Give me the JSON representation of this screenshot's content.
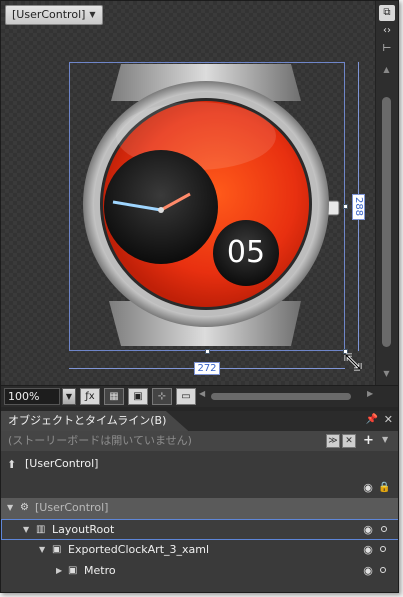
{
  "artboard": {
    "scope_button_label": "[UserControl]",
    "watch_number": "05",
    "width_label": "272",
    "height_label": "288"
  },
  "canvas_toolbar": {
    "zoom_value": "100%"
  },
  "objects_panel": {
    "tab_title": "オブジェクトとタイムライン(B)",
    "storyboard_status": "(ストーリーボードは開いていません)",
    "scope_label": "[UserControl]",
    "tree": [
      {
        "label": "[UserControl]"
      },
      {
        "label": "LayoutRoot"
      },
      {
        "label": "ExportedClockArt_3_xaml"
      },
      {
        "label": "Metro"
      }
    ]
  },
  "colors": {
    "selection": "#5e86d8",
    "dimension_text": "#3a64c8",
    "watch_face": "#e83010"
  },
  "icons": [
    "dropdown-caret-icon",
    "pan-icon",
    "code-icon",
    "split-icon",
    "grid-icon",
    "snap-icon",
    "annotation-icon",
    "pin-icon",
    "close-icon",
    "eye-icon",
    "lock-icon",
    "resize-cursor-icon"
  ]
}
